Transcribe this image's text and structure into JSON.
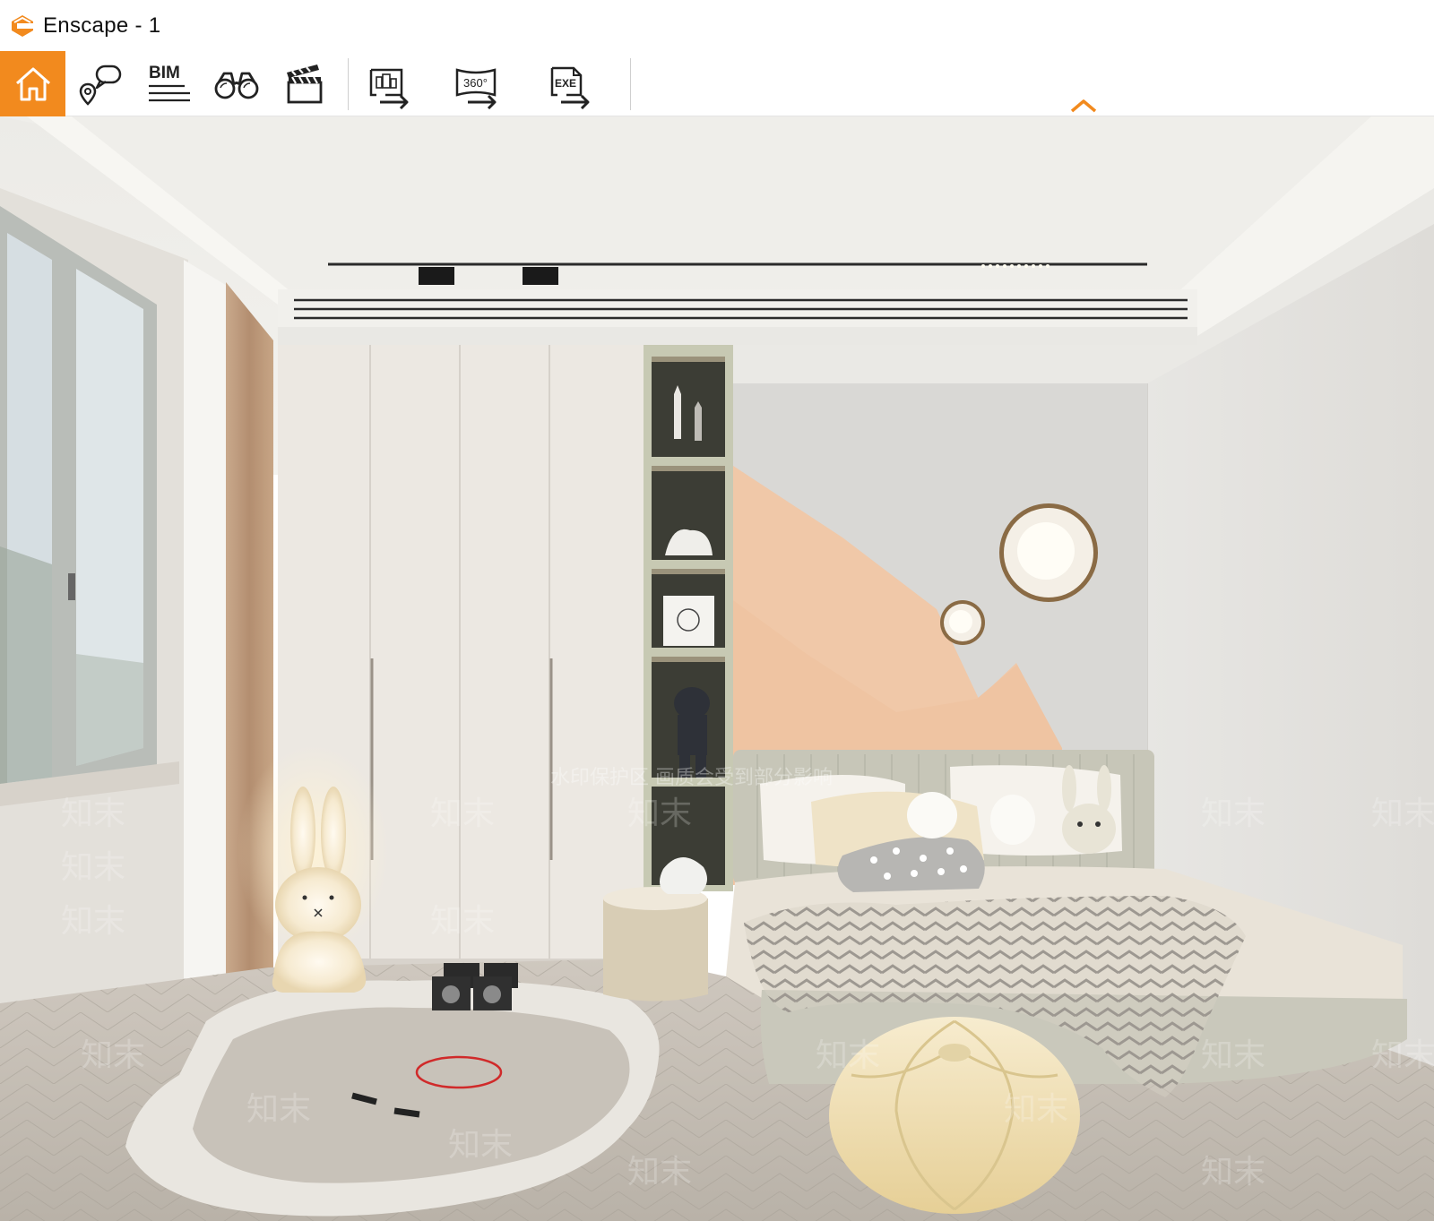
{
  "window": {
    "title": "Enscape - 1"
  },
  "toolbar": {
    "items": [
      {
        "name": "home",
        "icon": "home-icon"
      },
      {
        "name": "views",
        "icon": "location-chat-icon"
      },
      {
        "name": "bim",
        "icon": "bim-icon",
        "label": "BIM"
      },
      {
        "name": "binoculars",
        "icon": "binoculars-icon"
      },
      {
        "name": "video",
        "icon": "clapperboard-icon"
      },
      {
        "name": "export-image",
        "icon": "export-image-icon"
      },
      {
        "name": "export-panorama",
        "icon": "export-panorama-icon",
        "label": "360°"
      },
      {
        "name": "export-exe",
        "icon": "export-exe-icon",
        "label": "EXE"
      }
    ],
    "accent": "#f28a1e"
  },
  "viewport": {
    "watermark_banner": "水印保护区   画质会受到部分影响",
    "watermark_tile": "知末"
  }
}
